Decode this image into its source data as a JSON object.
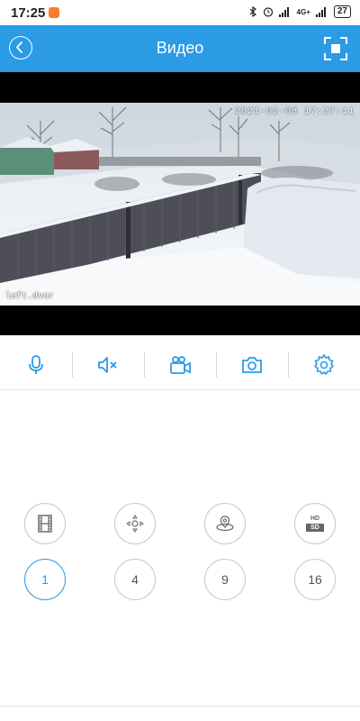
{
  "status_bar": {
    "time": "17:25",
    "network": "4G+",
    "battery": "27"
  },
  "header": {
    "title": "Видео",
    "back_icon": "back-chevron-icon",
    "fullscreen_icon": "fullscreen-icon"
  },
  "video": {
    "timestamp": "2021-02-08 17:27:11",
    "camera_name": "left.dvor"
  },
  "toolbar": {
    "items": [
      {
        "icon": "microphone-icon"
      },
      {
        "icon": "speaker-muted-icon"
      },
      {
        "icon": "video-record-icon"
      },
      {
        "icon": "snapshot-icon"
      },
      {
        "icon": "settings-icon"
      }
    ]
  },
  "controls": {
    "hd_label": "HD",
    "sd_label": "SD"
  },
  "layout_buttons": [
    {
      "label": "1",
      "active": true
    },
    {
      "label": "4",
      "active": false
    },
    {
      "label": "9",
      "active": false
    },
    {
      "label": "16",
      "active": false
    }
  ],
  "colors": {
    "accent": "#2b9be6",
    "status_app_icon": "#ff7a2f"
  }
}
